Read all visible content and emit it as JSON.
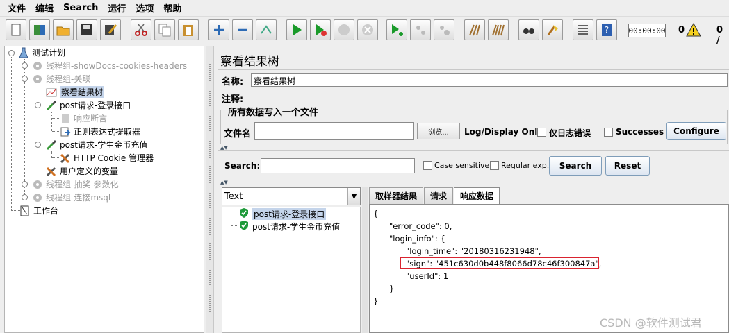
{
  "menubar": [
    "文件",
    "编辑",
    "Search",
    "运行",
    "选项",
    "帮助"
  ],
  "toolbar": {
    "icons": [
      "new-icon",
      "templates-icon",
      "open-icon",
      "save-icon",
      "save-as-icon",
      "cut-icon",
      "copy-icon",
      "paste-icon",
      "expand-icon",
      "collapse-icon",
      "toggle-icon",
      "start-icon",
      "start-no-timers-icon",
      "stop-icon",
      "shutdown-icon",
      "remote-start-icon",
      "remote-stop-icon",
      "remote-shutdown-icon",
      "clear-icon",
      "clear-all-icon",
      "search-icon",
      "reset-search-icon",
      "function-helper-icon",
      "help-icon"
    ],
    "timer": "00:00:00",
    "error_count": "0",
    "threads": "0 /"
  },
  "tree": {
    "root": "测试计划",
    "items": [
      {
        "label": "线程组-showDocs-cookies-headers",
        "disabled": true
      },
      {
        "label": "线程组-关联",
        "disabled": true
      },
      {
        "label": "察看结果树",
        "selected": true
      },
      {
        "label": "post请求-登录接口"
      },
      {
        "label": "响应断言",
        "disabled": true
      },
      {
        "label": "正则表达式提取器"
      },
      {
        "label": "post请求-学生金币充值"
      },
      {
        "label": "HTTP Cookie 管理器"
      },
      {
        "label": "用户定义的变量"
      },
      {
        "label": "线程组-抽奖-参数化",
        "disabled": true
      },
      {
        "label": "线程组-连接msql",
        "disabled": true
      }
    ],
    "workbench": "工作台"
  },
  "panel": {
    "title": "察看结果树",
    "name_label": "名称:",
    "name_value": "察看结果树",
    "comment_label": "注释:",
    "group_title": "所有数据写入一个文件",
    "filename_label": "文件名",
    "browse": "浏览...",
    "log_display": "Log/Display Only:",
    "errors_only": "仅日志错误",
    "successes": "Successes",
    "configure": "Configure",
    "search_label": "Search:",
    "case_sensitive": "Case sensitive",
    "regular_exp": "Regular exp.",
    "search_button": "Search",
    "reset_button": "Reset"
  },
  "results": {
    "renderer": "Text",
    "samples": [
      "post请求-登录接口",
      "post请求-学生金币充值"
    ],
    "tabs": [
      "取样器结果",
      "请求",
      "响应数据"
    ],
    "active_tab": "响应数据",
    "response_lines": [
      "{",
      "\"error_code\": 0,",
      "\"login_info\": {",
      "\"login_time\": \"20180316231948\",",
      "\"sign\": \"451c630d0b448f8066d78c46f300847a\",",
      "\"userId\": 1",
      "}",
      "}"
    ]
  },
  "watermark": "CSDN @软件测试君"
}
